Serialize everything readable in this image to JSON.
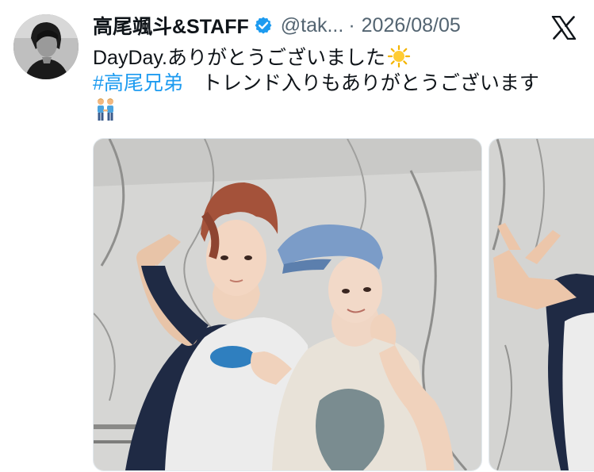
{
  "post": {
    "author": {
      "display_name": "高尾颯斗&STAFF",
      "handle": "@tak...",
      "separator": "·",
      "date": "2026/08/05",
      "verified": true,
      "avatar_icon": "avatar-photo"
    },
    "platform_icon": "x-logo-icon",
    "text": {
      "line1": "DayDay.ありがとうございました",
      "line1_emoji": "sun-emoji",
      "hashtag": "#高尾兄弟",
      "line2_rest": "トレンド入りもありがとうございます",
      "line3_emoji": "men-holding-hands-emoji"
    },
    "media": [
      {
        "description_icon": "photo-two-people-icon"
      },
      {
        "description_icon": "photo-peace-sign-icon"
      }
    ],
    "colors": {
      "text": "#0f1419",
      "muted": "#536471",
      "hashtag": "#1d9bf0",
      "verified": "#1d9bf0"
    }
  }
}
